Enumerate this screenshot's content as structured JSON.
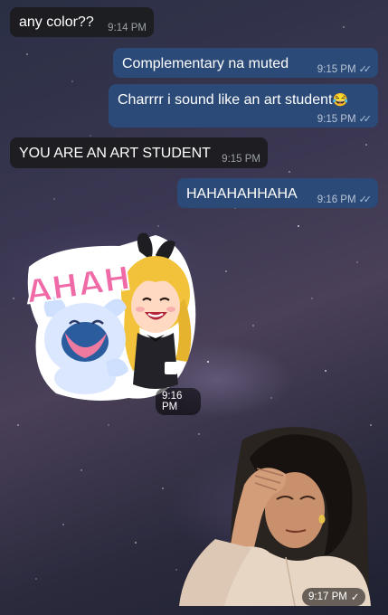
{
  "messages": [
    {
      "text": "any color??",
      "time": "9:14 PM"
    },
    {
      "text": "Complementary na muted",
      "time": "9:15 PM"
    },
    {
      "text": "Charrrr i sound like an art student",
      "emoji": "😂",
      "time": "9:15 PM"
    },
    {
      "text": "YOU ARE AN ART STUDENT",
      "time": "9:15 PM"
    },
    {
      "text": "HAHAHAHHAHA",
      "time": "9:16 PM"
    }
  ],
  "sticker": {
    "text": "AHAH",
    "time": "9:16 PM"
  },
  "photo": {
    "time": "9:17 PM"
  },
  "colors": {
    "outgoing": "#2b4a77",
    "incoming": "#1c1c1e",
    "ticks": "#a9c0dd"
  }
}
